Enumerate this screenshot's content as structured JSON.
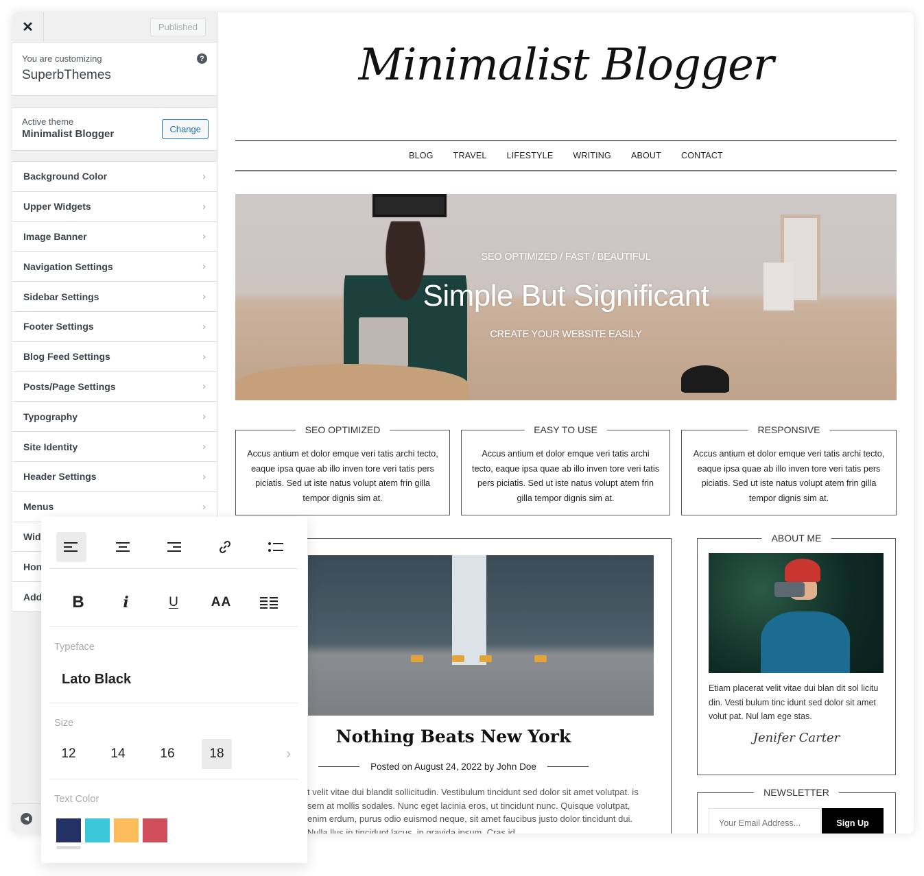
{
  "customizer": {
    "close_icon": "close-icon",
    "published_label": "Published",
    "customizing_label": "You are customizing",
    "site_name": "SuperbThemes",
    "help_icon": "?",
    "active_theme_label": "Active theme",
    "active_theme_name": "Minimalist Blogger",
    "change_label": "Change",
    "menu": [
      {
        "label": "Background Color"
      },
      {
        "label": "Upper Widgets"
      },
      {
        "label": "Image Banner"
      },
      {
        "label": "Navigation Settings"
      },
      {
        "label": "Sidebar Settings"
      },
      {
        "label": "Footer Settings"
      },
      {
        "label": "Blog Feed Settings"
      },
      {
        "label": "Posts/Page Settings"
      },
      {
        "label": "Typography"
      },
      {
        "label": "Site Identity"
      },
      {
        "label": "Header Settings"
      },
      {
        "label": "Menus"
      },
      {
        "label": "Wid"
      },
      {
        "label": "Hon"
      },
      {
        "label": "Add"
      }
    ],
    "chevron": "›"
  },
  "site": {
    "logo": "Minimalist Blogger",
    "nav": [
      "BLOG",
      "TRAVEL",
      "LIFESTYLE",
      "WRITING",
      "ABOUT",
      "CONTACT"
    ],
    "hero": {
      "subtitle": "SEO OPTIMIZED / FAST / BEAUTIFUL",
      "title": "Simple But Significant",
      "cta": "CREATE YOUR WEBSITE EASILY"
    },
    "features": [
      {
        "title": "SEO OPTIMIZED",
        "text": "Accus antium et dolor emque veri tatis archi tecto, eaque ipsa quae ab illo inven tore veri tatis pers piciatis. Sed ut iste natus volupt atem frin gilla tempor dignis sim at."
      },
      {
        "title": "EASY TO USE",
        "text": "Accus antium et dolor emque veri tatis archi tecto, eaque ipsa quae ab illo inven tore veri tatis pers piciatis. Sed ut iste natus volupt atem frin gilla tempor dignis sim at."
      },
      {
        "title": "RESPONSIVE",
        "text": "Accus antium et dolor emque veri tatis archi tecto, eaque ipsa quae ab illo inven tore veri tatis pers piciatis. Sed ut iste natus volupt atem frin gilla tempor dignis sim at."
      }
    ],
    "post": {
      "title": "Nothing Beats New York",
      "meta": "Posted on August 24, 2022 by John Doe",
      "excerpt": "t velit vitae dui blandit sollicitudin. Vestibulum tincidunt sed dolor sit amet volutpat. is sem at mollis sodales. Nunc eget lacinia eros, ut tincidunt nunc. Quisque volutpat, enim erdum, purus odio euismod neque, sit amet faucibus justo dolor tincidunt dui. Nulla llus in tincidunt lacus, in gravida ipsum. Cras id"
    },
    "about": {
      "title": "ABOUT ME",
      "text": "Etiam placerat velit vitae dui blan dit sol licitu din. Vesti bulum tinc idunt sed dolor sit amet volut pat. Nul lam ege stas.",
      "signature": "Jenifer Carter"
    },
    "newsletter": {
      "title": "NEWSLETTER",
      "placeholder": "Your Email Address...",
      "button": "Sign Up"
    }
  },
  "typography_panel": {
    "alignment_tools": [
      "align-left",
      "align-center",
      "align-right",
      "link",
      "list"
    ],
    "active_alignment": "align-left",
    "format_tools": {
      "bold": "B",
      "italic": "i",
      "underline": "U",
      "case": "AA"
    },
    "typeface_label": "Typeface",
    "typeface_value": "Lato Black",
    "size_label": "Size",
    "sizes": [
      "12",
      "14",
      "16",
      "18"
    ],
    "selected_size": "18",
    "text_color_label": "Text Color",
    "colors": [
      "#243165",
      "#3ac8d8",
      "#fdbd5c",
      "#d14f5d"
    ],
    "selected_color": "#243165"
  }
}
